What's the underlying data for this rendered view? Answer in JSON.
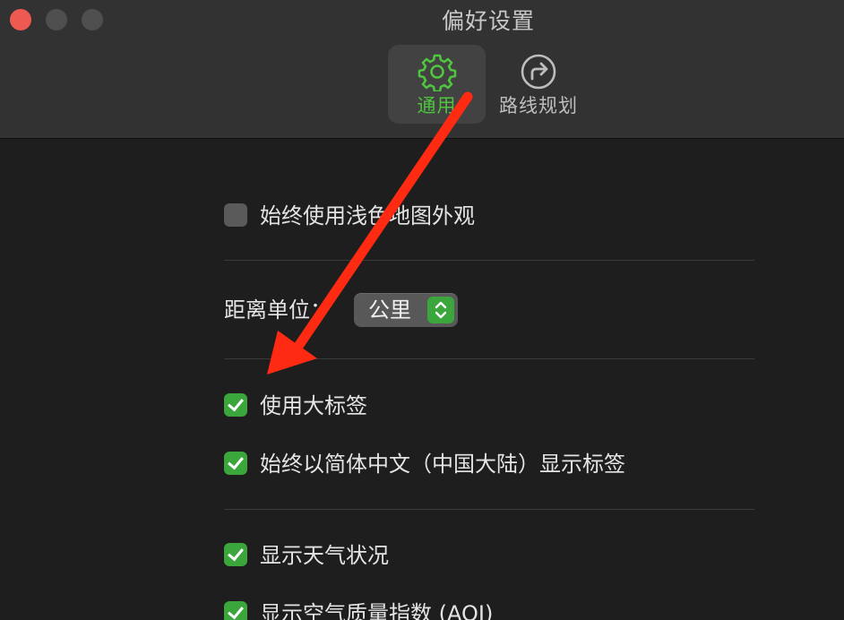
{
  "window": {
    "title": "偏好设置",
    "traffic_lights": [
      "close",
      "minimize",
      "maximize"
    ]
  },
  "toolbar": {
    "tabs": [
      {
        "label": "通用",
        "icon": "gear-icon",
        "active": true
      },
      {
        "label": "路线规划",
        "icon": "route-arrow-icon",
        "active": false
      }
    ]
  },
  "settings": {
    "light_map": {
      "label": "始终使用浅色地图外观",
      "checked": false
    },
    "distance": {
      "label": "距离单位：",
      "value": "公里"
    },
    "large_labels": {
      "label": "使用大标签",
      "checked": true
    },
    "simplified_chinese": {
      "label": "始终以简体中文（中国大陆）显示标签",
      "checked": true
    },
    "weather": {
      "label": "显示天气状况",
      "checked": true
    },
    "aqi": {
      "label": "显示空气质量指数 (AQI)",
      "checked": true
    }
  },
  "colors": {
    "accent_green": "#3aa63c",
    "annotation_red": "#ff2a12"
  }
}
